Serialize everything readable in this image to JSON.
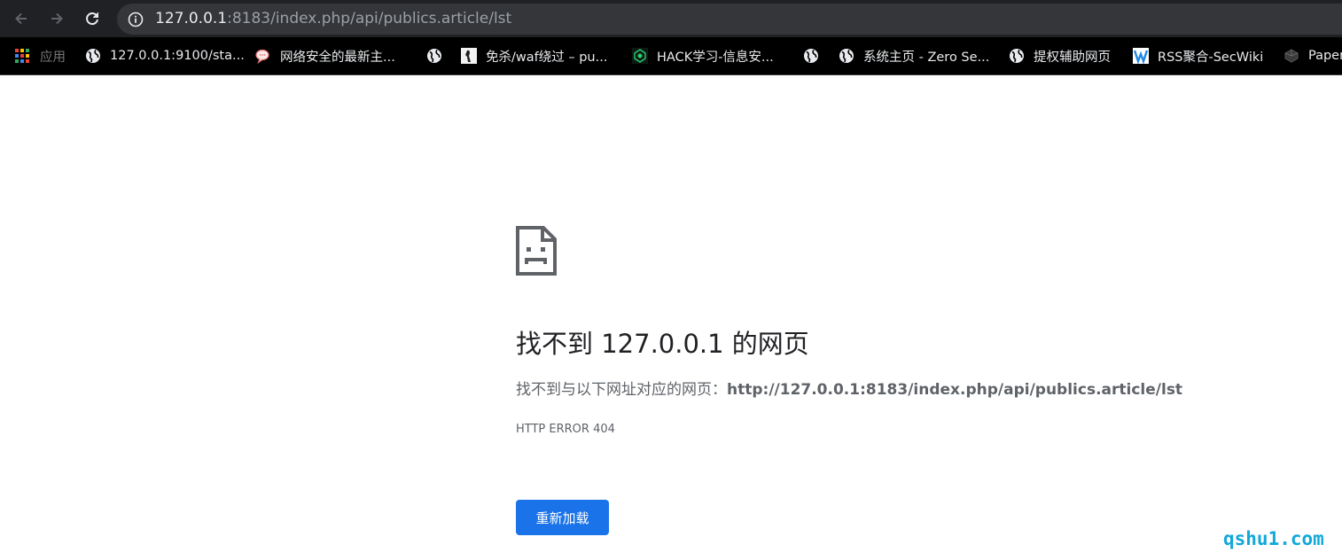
{
  "browser": {
    "url_host": "127.0.0.1",
    "url_rest": ":8183/index.php/api/publics.article/lst"
  },
  "bookmarks": [
    {
      "label": "应用",
      "icon": "apps-grid-icon"
    },
    {
      "label": "127.0.0.1:9100/sta...",
      "icon": "globe-icon"
    },
    {
      "label": "网络安全的最新主...",
      "icon": "chat-bubble-icon"
    },
    {
      "label": "",
      "icon": "globe-icon"
    },
    {
      "label": "免杀/waf绕过 – pu...",
      "icon": "site-favicon-icon"
    },
    {
      "label": "HACK学习-信息安...",
      "icon": "hack-favicon-icon"
    },
    {
      "label": "",
      "icon": "globe-icon"
    },
    {
      "label": "系统主页 - Zero Se...",
      "icon": "globe-icon"
    },
    {
      "label": "提权辅助网页",
      "icon": "globe-icon"
    },
    {
      "label": "RSS聚合-SecWiki",
      "icon": "secwiki-favicon-icon"
    },
    {
      "label": "Paper",
      "icon": "paper-favicon-icon"
    }
  ],
  "error_page": {
    "heading": "找不到 127.0.0.1 的网页",
    "description_prefix": "找不到与以下网址对应的网页：",
    "description_url": "http://127.0.0.1:8183/index.php/api/publics.article/lst",
    "error_code": "HTTP ERROR 404",
    "reload_label": "重新加载"
  },
  "watermark": "qshu1.com",
  "colors": {
    "toolbar_bg": "#202124",
    "bookmarks_bg": "#000000",
    "button_blue": "#1a73e8",
    "watermark": "#12a8d9"
  }
}
